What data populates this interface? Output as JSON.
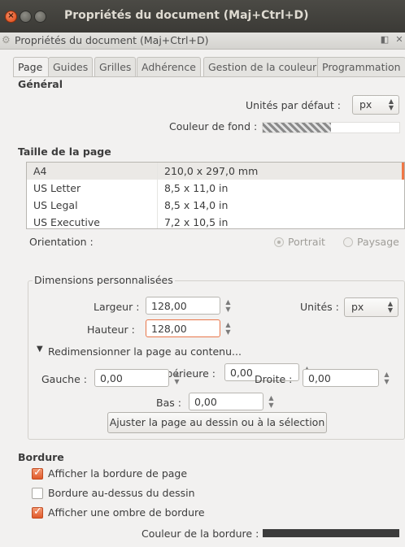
{
  "window": {
    "title": "Propriétés du document (Maj+Ctrl+D)",
    "close_glyph": "×"
  },
  "dock": {
    "title": "Propriétés du document (Maj+Ctrl+D)",
    "icon": "gear-icon"
  },
  "tabs": [
    "Page",
    "Guides",
    "Grilles",
    "Adhérence",
    "Gestion de la couleur",
    "Programmation"
  ],
  "general": {
    "heading": "Général",
    "units_label": "Unités par défaut :",
    "units_value": "px",
    "bg_label": "Couleur de fond :"
  },
  "page_size": {
    "heading": "Taille de la page",
    "rows": [
      {
        "name": "A4",
        "size": "210,0 x 297,0 mm"
      },
      {
        "name": "US Letter",
        "size": "8,5 x 11,0 in"
      },
      {
        "name": "US Legal",
        "size": "8,5 x 14,0 in"
      },
      {
        "name": "US Executive",
        "size": "7,2 x 10,5 in"
      }
    ],
    "orientation_label": "Orientation :",
    "portrait": "Portrait",
    "landscape": "Paysage"
  },
  "custom": {
    "legend": "Dimensions personnalisées",
    "width_label": "Largeur :",
    "width_value": "128,00",
    "height_label": "Hauteur :",
    "height_value": "128,00",
    "units_label": "Unités :",
    "units_value": "px",
    "resize_label": "Redimensionner la page au contenu...",
    "top_margin_label": "Marge supérieure :",
    "top_margin_value": "0,00",
    "left_label": "Gauche :",
    "left_value": "0,00",
    "right_label": "Droite :",
    "right_value": "0,00",
    "bottom_label": "Bas :",
    "bottom_value": "0,00",
    "fit_button": "Ajuster la page au dessin ou à la sélection"
  },
  "border": {
    "heading": "Bordure",
    "show_border": "Afficher la bordure de page",
    "border_on_top": "Bordure au-dessus du dessin",
    "show_shadow": "Afficher une ombre de bordure",
    "color_label": "Couleur de la bordure :"
  },
  "colors": {
    "accent": "#e05a2b",
    "border_swatch": "#3c3c3c"
  }
}
